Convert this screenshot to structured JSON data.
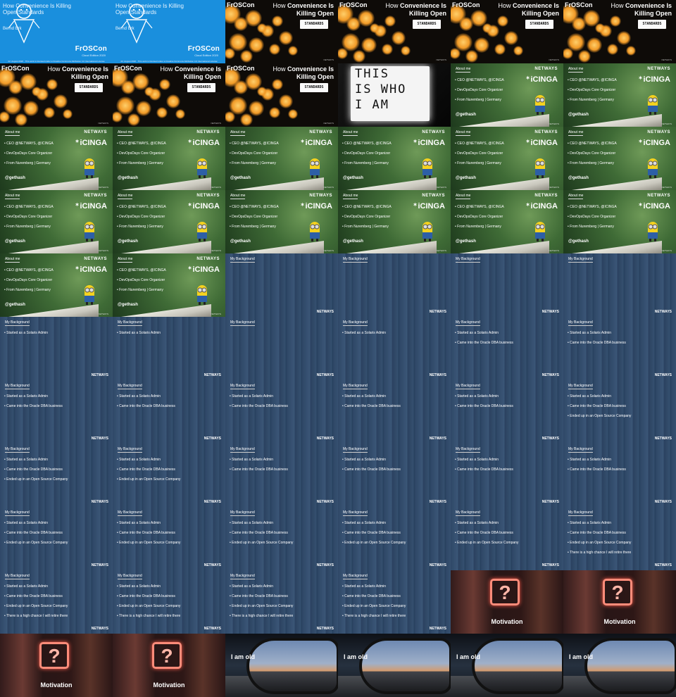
{
  "deck": {
    "title_slide": {
      "talk_title": "How Convenience Is Killing Open Standards",
      "author": "Bernd Erk",
      "conference": "FrOSCon",
      "edition": "Cloud Edition 2020",
      "date": "22. August 2020",
      "footer": "This work is licensed under a Creative Commons Attribution 4.0 International License"
    },
    "bokeh_slide": {
      "conference": "FrOSCon",
      "heading_light": "How",
      "heading_bold": "Convenience Is Killing Open",
      "sign": "STANDARDS",
      "brand": "NETWAYS"
    },
    "lightbox_slide": {
      "lines": [
        "THIS",
        "IS WHO",
        "I AM"
      ]
    },
    "about_slide": {
      "caption": "About me",
      "bullets": [
        "• CEO @NETWAYS, @ICINGA",
        "• DevOpsDays Core Organizer",
        "• From Nuremberg | Germany"
      ],
      "handle": "@gethash",
      "netways": "NETWAYS",
      "icinga": "iCINGA",
      "brand": "NETWAYS"
    },
    "background_slide": {
      "caption": "My Background",
      "bullets": [
        "• Started as a Solaris Admin",
        "• Came into the Oracle DBA business",
        "• Ended up in an Open Source Company",
        "• There is a high chance I will retire there"
      ],
      "brand": "NETWAYS"
    },
    "motivation_slide": {
      "label": "Motivation"
    },
    "mirror_slide": {
      "label": "I am old"
    }
  },
  "frames": [
    {
      "type": "title"
    },
    {
      "type": "title"
    },
    {
      "type": "bokeh"
    },
    {
      "type": "bokeh"
    },
    {
      "type": "bokeh"
    },
    {
      "type": "bokeh"
    },
    {
      "type": "bokeh"
    },
    {
      "type": "bokeh"
    },
    {
      "type": "bokeh"
    },
    {
      "type": "lightbox"
    },
    {
      "type": "about"
    },
    {
      "type": "about"
    },
    {
      "type": "about"
    },
    {
      "type": "about"
    },
    {
      "type": "about"
    },
    {
      "type": "about"
    },
    {
      "type": "about"
    },
    {
      "type": "about"
    },
    {
      "type": "about"
    },
    {
      "type": "about"
    },
    {
      "type": "about"
    },
    {
      "type": "about"
    },
    {
      "type": "about"
    },
    {
      "type": "about"
    },
    {
      "type": "about"
    },
    {
      "type": "about"
    },
    {
      "type": "background",
      "bullets": 0
    },
    {
      "type": "background",
      "bullets": 0
    },
    {
      "type": "background",
      "bullets": 0
    },
    {
      "type": "background",
      "bullets": 0
    },
    {
      "type": "background",
      "bullets": 1
    },
    {
      "type": "background",
      "bullets": 1
    },
    {
      "type": "background",
      "bullets": 0
    },
    {
      "type": "background",
      "bullets": 1
    },
    {
      "type": "background",
      "bullets": 2
    },
    {
      "type": "background",
      "bullets": 2
    },
    {
      "type": "background",
      "bullets": 2
    },
    {
      "type": "background",
      "bullets": 2
    },
    {
      "type": "background",
      "bullets": 2
    },
    {
      "type": "background",
      "bullets": 2
    },
    {
      "type": "background",
      "bullets": 2
    },
    {
      "type": "background",
      "bullets": 3
    },
    {
      "type": "background",
      "bullets": 3
    },
    {
      "type": "background",
      "bullets": 3
    },
    {
      "type": "background",
      "bullets": 2
    },
    {
      "type": "background",
      "bullets": 2
    },
    {
      "type": "background",
      "bullets": 2
    },
    {
      "type": "background",
      "bullets": 2
    },
    {
      "type": "background",
      "bullets": 3
    },
    {
      "type": "background",
      "bullets": 3
    },
    {
      "type": "background",
      "bullets": 3
    },
    {
      "type": "background",
      "bullets": 3
    },
    {
      "type": "background",
      "bullets": 3
    },
    {
      "type": "background",
      "bullets": 4
    },
    {
      "type": "background",
      "bullets": 4
    },
    {
      "type": "background",
      "bullets": 4
    },
    {
      "type": "background",
      "bullets": 4
    },
    {
      "type": "background",
      "bullets": 4
    },
    {
      "type": "motivation"
    },
    {
      "type": "motivation"
    },
    {
      "type": "motivation"
    },
    {
      "type": "motivation"
    },
    {
      "type": "mirror"
    },
    {
      "type": "mirror"
    },
    {
      "type": "mirror"
    },
    {
      "type": "mirror"
    }
  ]
}
